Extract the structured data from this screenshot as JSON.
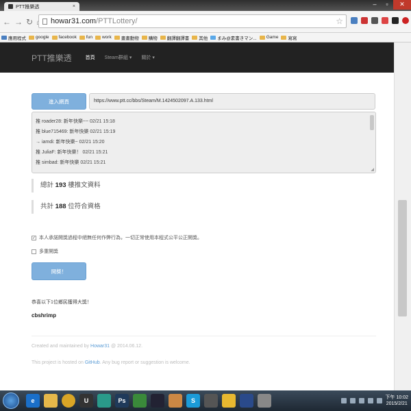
{
  "browser": {
    "tab_title": "PTT推樂透",
    "url_host": "howar31.com",
    "url_path": "/PTTLottery/"
  },
  "bookmarks": [
    {
      "label": "應用程式",
      "icon": "apps-icon"
    },
    {
      "label": "google",
      "icon": "folder-icon"
    },
    {
      "label": "facebook",
      "icon": "folder-icon"
    },
    {
      "label": "fun",
      "icon": "folder-icon"
    },
    {
      "label": "work",
      "icon": "folder-icon"
    },
    {
      "label": "畫畫動物",
      "icon": "folder-icon"
    },
    {
      "label": "購物",
      "icon": "folder-icon"
    },
    {
      "label": "翻譯翻譯書",
      "icon": "folder-icon"
    },
    {
      "label": "其他",
      "icon": "folder-icon"
    },
    {
      "label": "まみ@素書きマン...",
      "icon": "twitter-icon"
    },
    {
      "label": "Game",
      "icon": "folder-icon"
    },
    {
      "label": "寫寫",
      "icon": "folder-icon"
    }
  ],
  "site_nav": {
    "brand": "PTT推樂透",
    "items": [
      {
        "label": "首頁",
        "active": true
      },
      {
        "label": "Steam群組 ▾",
        "active": false
      },
      {
        "label": "關於 ▾",
        "active": false
      }
    ]
  },
  "form": {
    "enter_button": "進入網頁",
    "url_value": "https://www.ptt.cc/bbs/Steam/M.1424502097.A.133.html"
  },
  "pushes": [
    "推 roader28: 新年快樂~~ 02/21 15:18",
    "推 blue715469: 新年快樂 02/21 15:19",
    "→ iamdi: 新年快樂~ 02/21 15:20",
    "推 JuliaF: 新年快樂！ 02/21 15:21",
    "推 simbad: 新年快樂 02/21 15:21"
  ],
  "stats": {
    "total_prefix": "總計",
    "total_count": "193",
    "total_suffix": "樓推文資料",
    "qualified_prefix": "共計",
    "qualified_count": "188",
    "qualified_suffix": "位符合資格"
  },
  "options": {
    "agree_label": "本人承諾開獎過程中絕無任何作弊行為，一切正常使用本程式公平公正開獎。",
    "repeat_label": "多重開獎"
  },
  "draw_button": "開獎！",
  "result": {
    "congrats": "恭喜以下1位鄉民獲得大獎！",
    "winner": "cbshrimp"
  },
  "footer": {
    "line1_prefix": "Created and maintained by",
    "author": "Howar31",
    "line1_suffix": "@ 2014.06.12.",
    "line2_prefix": "This project is hosted on",
    "host": "GitHub",
    "line2_suffix": ". Any bug report or suggestion is welcome."
  },
  "clock": {
    "time": "下午 10:02",
    "date": "2015/2/21"
  },
  "colors": {
    "button": "#7fb0dd",
    "navbar": "#222222",
    "link": "#5a9bd5"
  }
}
